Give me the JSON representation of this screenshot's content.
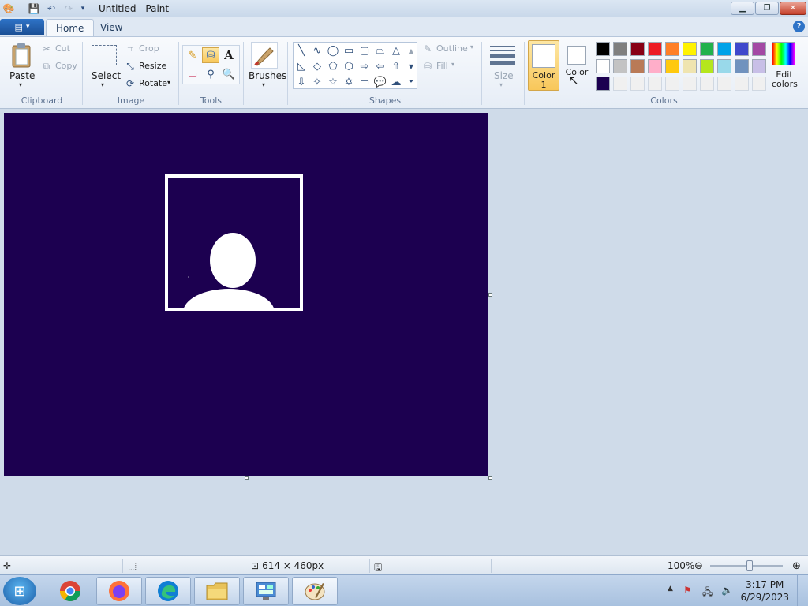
{
  "window": {
    "title": "Untitled - Paint"
  },
  "tabs": [
    {
      "label": "Home"
    },
    {
      "label": "View"
    }
  ],
  "clipboard": {
    "paste": "Paste",
    "cut": "Cut",
    "copy": "Copy",
    "label": "Clipboard"
  },
  "image": {
    "select": "Select",
    "crop": "Crop",
    "resize": "Resize",
    "rotate": "Rotate",
    "label": "Image"
  },
  "tools": {
    "label": "Tools",
    "text_glyph": "A"
  },
  "brushes": {
    "label": "Brushes"
  },
  "shapes": {
    "outline": "Outline",
    "fill": "Fill",
    "label": "Shapes"
  },
  "size": {
    "label": "Size"
  },
  "colors": {
    "color1": "Color 1",
    "color1_line1": "Color",
    "color1_line2": "1",
    "color2": "Color",
    "edit_line1": "Edit",
    "edit_line2": "colors",
    "label": "Colors",
    "palette_row1": [
      "#000000",
      "#7f7f7f",
      "#880015",
      "#ed1c24",
      "#ff7f27",
      "#fff200",
      "#22b14c",
      "#00a2e8",
      "#3f48cc",
      "#a349a4"
    ],
    "palette_row2": [
      "#ffffff",
      "#c3c3c3",
      "#b97a57",
      "#ffaec9",
      "#ffc90e",
      "#efe4b0",
      "#b5e61d",
      "#99d9ea",
      "#7092be",
      "#c8bfe7"
    ],
    "palette_row3": [
      "#1c0050",
      "#f0f0f0",
      "#f0f0f0",
      "#f0f0f0",
      "#f0f0f0",
      "#f0f0f0",
      "#f0f0f0",
      "#f0f0f0",
      "#f0f0f0",
      "#f0f0f0"
    ]
  },
  "canvas": {
    "background": "#1c0050"
  },
  "status": {
    "dimensions": "614 × 460px",
    "zoom": "100%"
  },
  "taskbar": {
    "time": "3:17 PM",
    "date": "6/29/2023"
  }
}
